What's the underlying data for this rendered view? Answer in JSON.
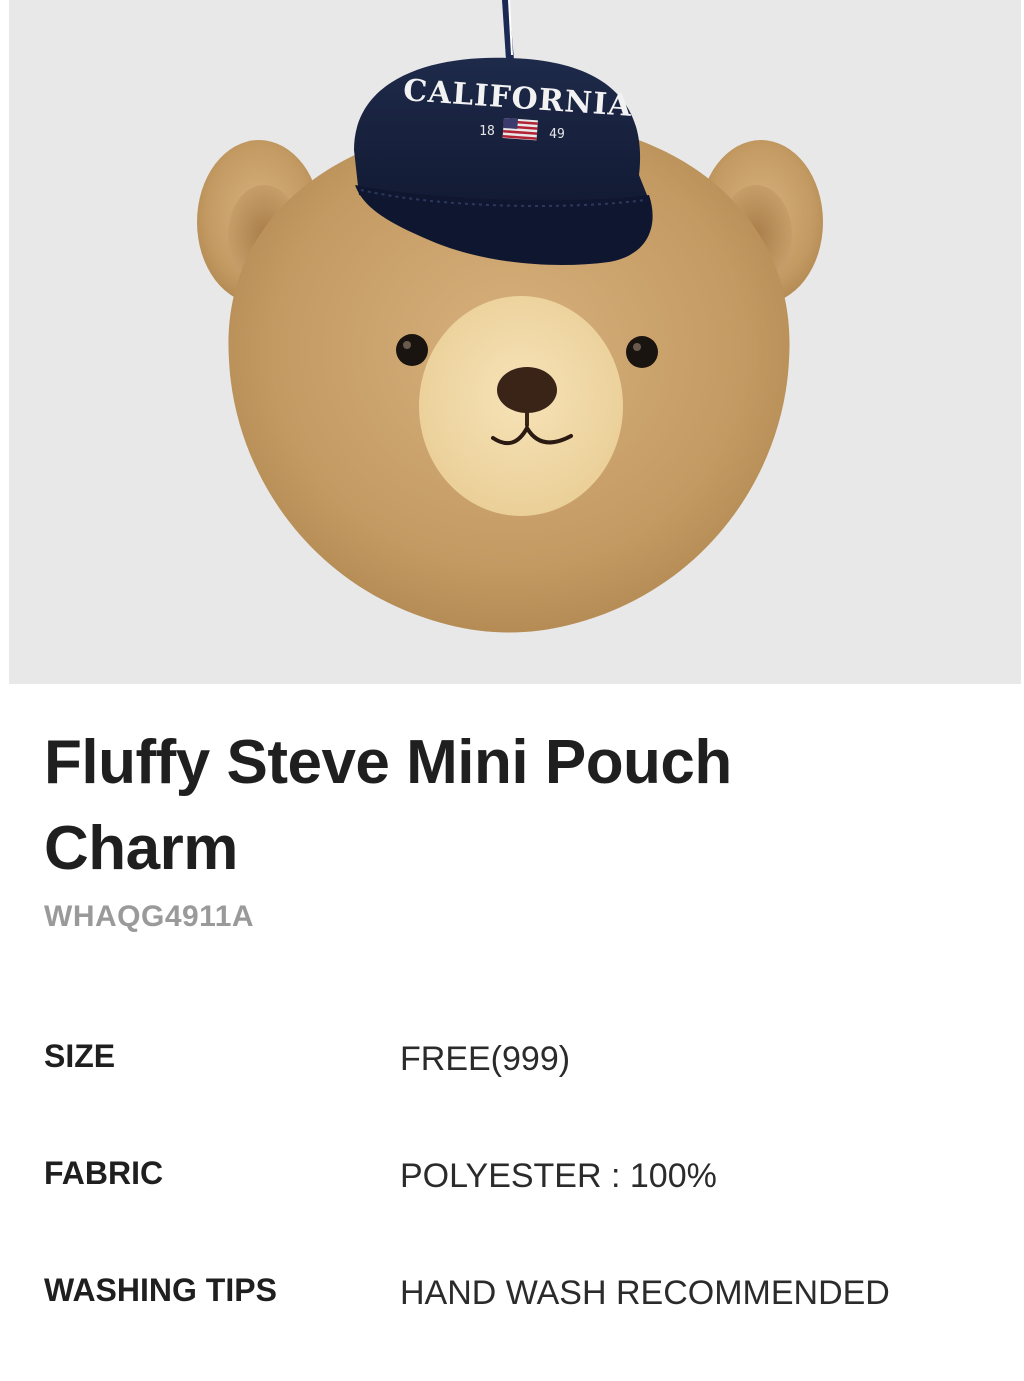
{
  "product": {
    "image_alt": "Fluffy bear head pouch charm wearing a navy California cap",
    "cap_text": "CALIFORNIA",
    "cap_year_left": "18",
    "cap_year_right": "49",
    "title": "Fluffy Steve Mini Pouch Charm",
    "code": "WHAQG4911A"
  },
  "specs": [
    {
      "label": "SIZE",
      "value": "FREE(999)"
    },
    {
      "label": "FABRIC",
      "value": "POLYESTER : 100%"
    },
    {
      "label": "WASHING TIPS",
      "value": "HAND WASH RECOMMENDED"
    }
  ],
  "colors": {
    "image_bg": "#e8e8e8",
    "fur": "#c9a06b",
    "muzzle": "#f1d9a6",
    "cap": "#17213d",
    "title_text": "#1f1f1f",
    "code_text": "#9a9a9a"
  }
}
